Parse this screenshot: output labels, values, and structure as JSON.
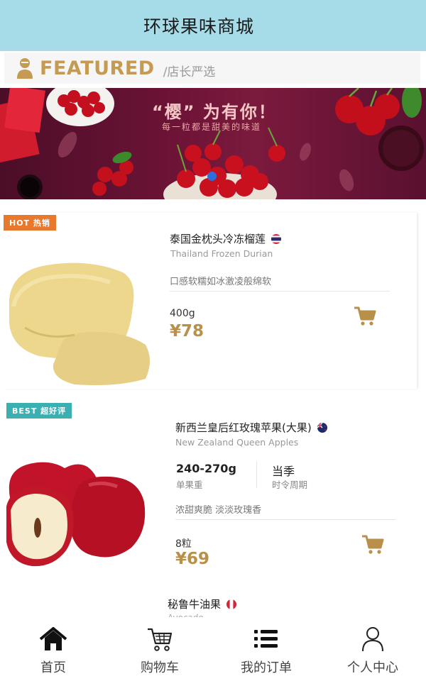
{
  "header": {
    "title": "环球果味商城"
  },
  "featured": {
    "title": "FEATURED",
    "subtitle": "/店长严选"
  },
  "banner": {
    "headline": "“樱” 为有你！",
    "tagline": "每一粒都是甜美的味道",
    "active_slide_dot_color": "#2f6fdc"
  },
  "products": [
    {
      "tag": "HOT 热销",
      "name": "泰国金枕头冷冻榴莲",
      "name_en": "Thailand Frozen Durian",
      "description": "口感软糯如冰激凌般绵软",
      "weight": "400g",
      "price": "¥78",
      "flag": "thailand-flag-icon"
    },
    {
      "tag": "BEST 超好评",
      "name": "新西兰皇后红玫瑰苹果(大果)",
      "name_en": "New Zealand Queen Apples",
      "spec_value_1": "240-270g",
      "spec_label_1": "单果重",
      "spec_value_2": "当季",
      "spec_label_2": "时令周期",
      "description": "浓甜爽脆 淡淡玫瑰香",
      "weight": "8粒",
      "price": "¥69",
      "flag": "new-zealand-flag-icon"
    },
    {
      "name": "秘鲁牛油果",
      "name_en": "Avocado",
      "flag": "peru-flag-icon"
    }
  ],
  "bottom_nav": [
    {
      "label": "首页",
      "icon": "home-icon"
    },
    {
      "label": "购物车",
      "icon": "cart-icon"
    },
    {
      "label": "我的订单",
      "icon": "list-icon"
    },
    {
      "label": "个人中心",
      "icon": "person-icon"
    }
  ],
  "colors": {
    "header_bg": "#a6dbe8",
    "accent_gold": "#c59a52",
    "price": "#b8904a",
    "hot_tag": "#e8782c",
    "best_tag": "#3bb0b3"
  }
}
